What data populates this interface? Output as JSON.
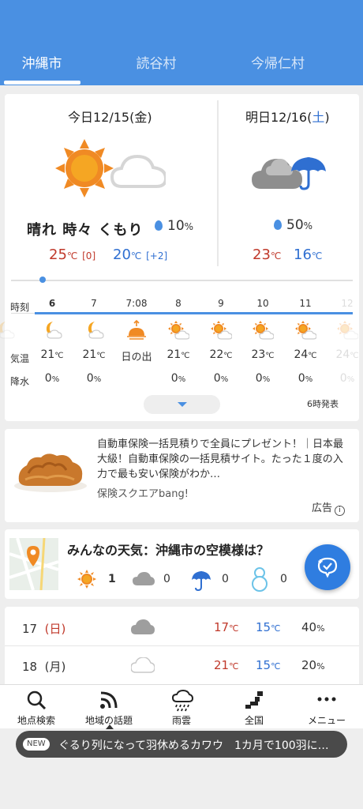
{
  "tabs": [
    {
      "label": "沖縄市",
      "active": true
    },
    {
      "label": "読谷村",
      "active": false
    },
    {
      "label": "今帰仁村",
      "active": false
    }
  ],
  "today": {
    "title_prefix": "今日12/15(",
    "weekday": "金",
    "title_suffix": ")",
    "weather": "晴れ 時々 くもり",
    "rain_value": "10",
    "rain_unit": "%",
    "high": "25",
    "high_unit": "℃",
    "high_diff": "[0]",
    "low": "20",
    "low_unit": "℃",
    "low_diff": "[+2]",
    "icon": "sun-with-cloud"
  },
  "tomorrow": {
    "title_prefix": "明日12/16(",
    "weekday": "土",
    "title_suffix": ")",
    "rain_value": "50",
    "rain_unit": "%",
    "high": "23",
    "high_unit": "℃",
    "low": "16",
    "low_unit": "℃",
    "icon": "cloud-with-umbrella"
  },
  "hourly": {
    "labels": {
      "time": "時刻",
      "temp": "気温",
      "precip": "降水"
    },
    "unit_c": "℃",
    "unit_pct": "%",
    "times": [
      "6",
      "7",
      "7:08",
      "8",
      "9",
      "10",
      "11",
      "12"
    ],
    "temps": [
      "21",
      "21",
      "日の出",
      "21",
      "22",
      "23",
      "24",
      "24"
    ],
    "precip": [
      "0",
      "0",
      "",
      "0",
      "0",
      "0",
      "0",
      "0"
    ],
    "icons": [
      "moon-cloud-icon",
      "moon-cloud-icon",
      "sunrise-icon",
      "sun-cloud-icon",
      "sun-cloud-icon",
      "sun-cloud-icon",
      "sun-cloud-icon",
      "sun-cloud-icon"
    ],
    "issued": "6時発表"
  },
  "ad": {
    "text": "自動車保険一括見積りで全員にプレゼント！｜日本最大級！自動車保険の一括見積サイト。たった１度の入力で最も安い保険がわか…",
    "source": "保険スクエアbang!",
    "label": "広告"
  },
  "community": {
    "title": "みんなの天気：沖縄市の空模様は？",
    "counts": [
      {
        "icon": "sun-icon",
        "value": "1"
      },
      {
        "icon": "cloud-icon",
        "value": "0"
      },
      {
        "icon": "umbrella-icon",
        "value": "0"
      },
      {
        "icon": "snowman-icon",
        "value": "0"
      }
    ]
  },
  "weekly": [
    {
      "day": "17",
      "weekday": "(日)",
      "icon": "cloud-icon",
      "high": "17",
      "low": "15",
      "pop": "40",
      "unit_c": "℃",
      "unit_pct": "%"
    },
    {
      "day": "18",
      "weekday": "(月)",
      "icon": "cloud-icon",
      "high": "21",
      "low": "15",
      "pop": "20",
      "unit_c": "℃",
      "unit_pct": "%"
    }
  ],
  "nav": [
    {
      "label": "地点検索",
      "icon": "search-icon"
    },
    {
      "label": "地域の話題",
      "icon": "rss-icon"
    },
    {
      "label": "雨雲",
      "icon": "rain-cloud-icon"
    },
    {
      "label": "全国",
      "icon": "japan-map-icon"
    },
    {
      "label": "メニュー",
      "icon": "more-icon"
    }
  ],
  "ticker": {
    "badge": "NEW",
    "text": "ぐるり列になって羽休めるカワウ　1カ月で100羽に…"
  },
  "colors": {
    "header": "#4a90e2",
    "high": "#c0392b",
    "low": "#2f6fd1",
    "fab": "#2f7de0"
  }
}
